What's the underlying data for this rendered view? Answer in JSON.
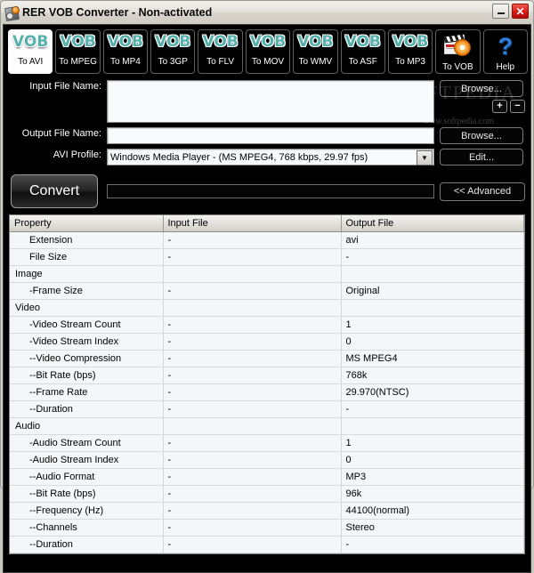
{
  "window": {
    "title": "RER VOB Converter - Non-activated",
    "icon": "app-icon",
    "minimize_label": "–",
    "close_label": "✕"
  },
  "toolbar": {
    "buttons": [
      {
        "glyph": "VOB",
        "label": "To AVI",
        "icon": "vob-icon",
        "active": true
      },
      {
        "glyph": "VOB",
        "label": "To MPEG",
        "icon": "vob-icon",
        "active": false
      },
      {
        "glyph": "VOB",
        "label": "To MP4",
        "icon": "vob-icon",
        "active": false
      },
      {
        "glyph": "VOB",
        "label": "To 3GP",
        "icon": "vob-icon",
        "active": false
      },
      {
        "glyph": "VOB",
        "label": "To FLV",
        "icon": "vob-icon",
        "active": false
      },
      {
        "glyph": "VOB",
        "label": "To MOV",
        "icon": "vob-icon",
        "active": false
      },
      {
        "glyph": "VOB",
        "label": "To WMV",
        "icon": "vob-icon",
        "active": false
      },
      {
        "glyph": "VOB",
        "label": "To ASF",
        "icon": "vob-icon",
        "active": false
      },
      {
        "glyph": "VOB",
        "label": "To MP3",
        "icon": "vob-icon",
        "active": false
      },
      {
        "glyph": "",
        "label": "To VOB",
        "icon": "clapperboard-disc-icon",
        "active": false
      },
      {
        "glyph": "?",
        "label": "Help",
        "icon": "question-mark-icon",
        "active": false
      }
    ]
  },
  "form": {
    "input_file_label": "Input File Name:",
    "input_file_value": "",
    "output_file_label": "Output File Name:",
    "output_file_value": "",
    "profile_label": "AVI Profile:",
    "profile_value": "Windows Media Player - (MS MPEG4, 768 kbps, 29.97 fps)",
    "browse_input_label": "Browse...",
    "browse_output_label": "Browse...",
    "edit_label": "Edit...",
    "add_label": "+",
    "remove_label": "−",
    "convert_label": "Convert",
    "advanced_label": "<< Advanced",
    "progress_value": 0
  },
  "watermark": {
    "big": "SOFTPEDIA",
    "small": "www.softpedia.com"
  },
  "table": {
    "columns": [
      "Property",
      "Input File",
      "Output File"
    ],
    "rows": [
      {
        "property": "Extension",
        "indent": 1,
        "input": "-",
        "output": "avi"
      },
      {
        "property": "File Size",
        "indent": 1,
        "input": "-",
        "output": "-"
      },
      {
        "property": "Image",
        "indent": 0,
        "input": "",
        "output": ""
      },
      {
        "property": "-Frame Size",
        "indent": 1,
        "input": "-",
        "output": "Original"
      },
      {
        "property": "Video",
        "indent": 0,
        "input": "",
        "output": ""
      },
      {
        "property": "-Video Stream Count",
        "indent": 1,
        "input": "-",
        "output": "1"
      },
      {
        "property": "-Video Stream Index",
        "indent": 1,
        "input": "-",
        "output": "0"
      },
      {
        "property": "--Video Compression",
        "indent": 1,
        "input": "-",
        "output": "MS MPEG4"
      },
      {
        "property": "--Bit Rate (bps)",
        "indent": 1,
        "input": "-",
        "output": "768k"
      },
      {
        "property": "--Frame Rate",
        "indent": 1,
        "input": "-",
        "output": "29.970(NTSC)"
      },
      {
        "property": "--Duration",
        "indent": 1,
        "input": "-",
        "output": "-"
      },
      {
        "property": "Audio",
        "indent": 0,
        "input": "",
        "output": ""
      },
      {
        "property": "-Audio Stream Count",
        "indent": 1,
        "input": "-",
        "output": "1"
      },
      {
        "property": "-Audio Stream Index",
        "indent": 1,
        "input": "-",
        "output": "0"
      },
      {
        "property": "--Audio Format",
        "indent": 1,
        "input": "-",
        "output": "MP3"
      },
      {
        "property": "--Bit Rate (bps)",
        "indent": 1,
        "input": "-",
        "output": "96k"
      },
      {
        "property": "--Frequency (Hz)",
        "indent": 1,
        "input": "-",
        "output": "44100(normal)"
      },
      {
        "property": "--Channels",
        "indent": 1,
        "input": "-",
        "output": "Stereo"
      },
      {
        "property": "--Duration",
        "indent": 1,
        "input": "-",
        "output": "-"
      }
    ]
  },
  "colors": {
    "accent_teal": "#56b0ac",
    "panel_black": "#000000",
    "close_red": "#d81a12",
    "disc_orange": "#f08a1e"
  }
}
